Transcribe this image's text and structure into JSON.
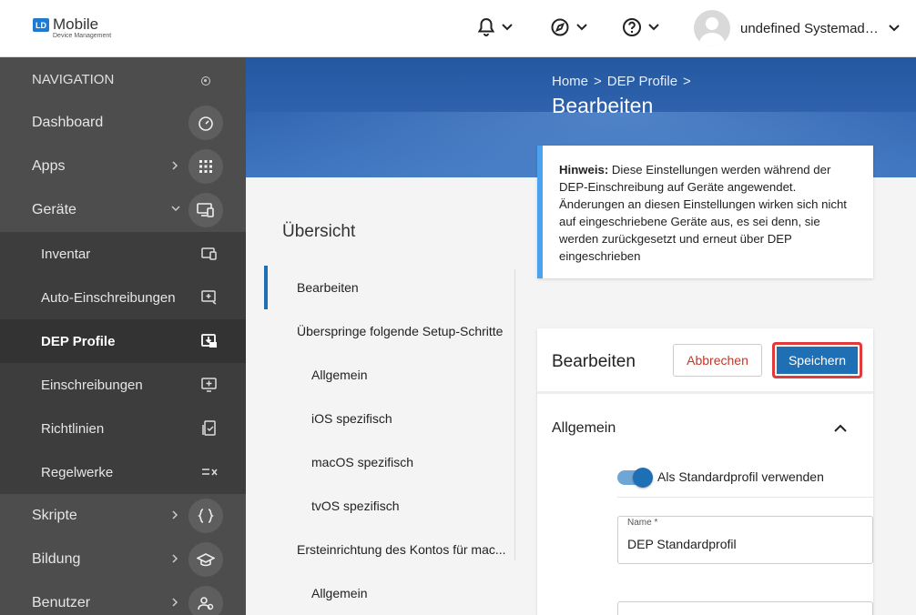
{
  "header": {
    "logo_badge": "LD",
    "logo_main": "Mobile",
    "logo_sub": "Device Management",
    "user_name": "undefined Systemadministrator"
  },
  "sidebar": {
    "heading": "NAVIGATION",
    "items": [
      {
        "label": "Dashboard",
        "icon": "speedometer-icon"
      },
      {
        "label": "Apps",
        "icon": "grid-icon"
      },
      {
        "label": "Geräte",
        "icon": "devices-icon"
      },
      {
        "label": "Inventar",
        "icon": "inventory-icon"
      },
      {
        "label": "Auto-Einschreibungen",
        "icon": "auto-enroll-icon"
      },
      {
        "label": "DEP Profile",
        "icon": "dep-profile-icon"
      },
      {
        "label": "Einschreibungen",
        "icon": "enroll-icon"
      },
      {
        "label": "Richtlinien",
        "icon": "policy-icon"
      },
      {
        "label": "Regelwerke",
        "icon": "rules-icon"
      },
      {
        "label": "Skripte",
        "icon": "braces-icon"
      },
      {
        "label": "Bildung",
        "icon": "graduation-icon"
      },
      {
        "label": "Benutzer",
        "icon": "users-icon"
      }
    ]
  },
  "breadcrumb": {
    "home": "Home",
    "section": "DEP Profile",
    "sep": ">"
  },
  "page": {
    "title": "Bearbeiten"
  },
  "overview": {
    "title": "Übersicht",
    "items": [
      {
        "label": "Bearbeiten"
      },
      {
        "label": "Überspringe folgende Setup-Schritte"
      },
      {
        "label": "Allgemein"
      },
      {
        "label": "iOS spezifisch"
      },
      {
        "label": "macOS spezifisch"
      },
      {
        "label": "tvOS spezifisch"
      },
      {
        "label": "Ersteinrichtung des Kontos für mac..."
      },
      {
        "label": "Allgemein"
      }
    ]
  },
  "hint": {
    "label": "Hinweis:",
    "text": "Diese Einstellungen werden während der DEP-Einschreibung auf Geräte angewendet. Änderungen an diesen Einstellungen wirken sich nicht auf eingeschriebene Geräte aus, es sei denn, sie werden zurückgesetzt und erneut über DEP eingeschrieben"
  },
  "editor": {
    "title": "Bearbeiten",
    "cancel_label": "Abbrechen",
    "save_label": "Speichern",
    "section_title": "Allgemein",
    "toggle_label": "Als Standardprofil verwenden",
    "name_label": "Name *",
    "name_value": "DEP Standardprofil"
  },
  "colors": {
    "accent": "#1f6fb5",
    "highlight": "#e03a3a",
    "sidebar": "#4d4d4d"
  }
}
